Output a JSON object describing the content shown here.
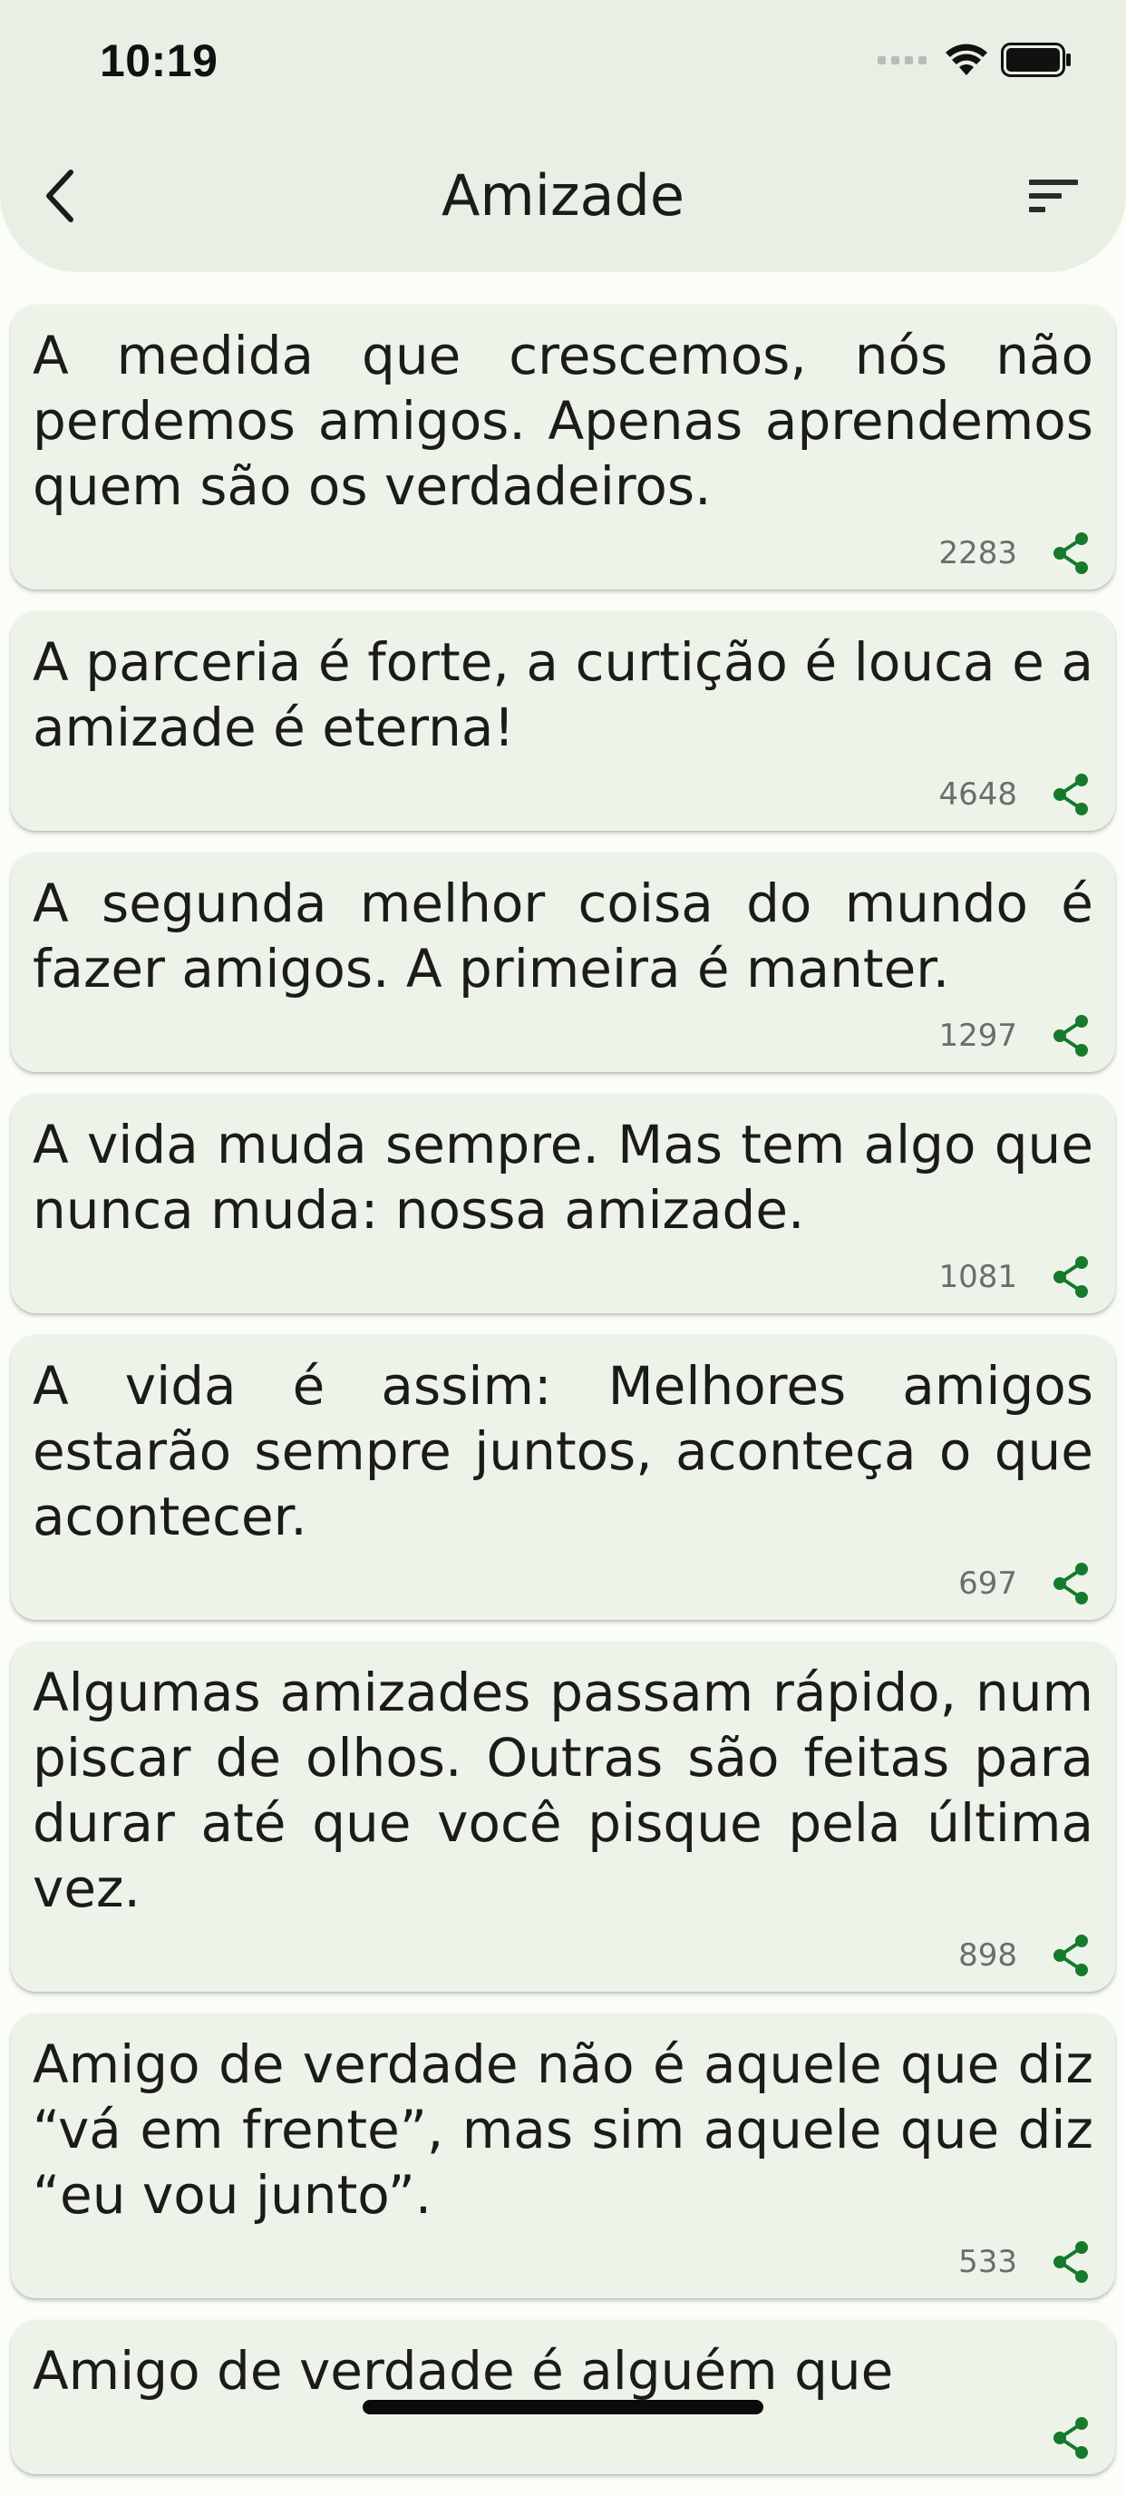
{
  "status_bar": {
    "time": "10:19"
  },
  "header": {
    "title": "Amizade"
  },
  "colors": {
    "accent": "#157a2c",
    "header_bg": "#e8efe4",
    "card_bg": "#eef3ea"
  },
  "icons": {
    "back": "chevron-left-icon",
    "sort": "sort-icon",
    "share": "share-icon"
  },
  "quotes": [
    {
      "text": "A medida que crescemos, nós não perdemos amigos. Apenas aprendemos quem são os verdadeiros.",
      "count": "2283"
    },
    {
      "text": "A parceria é forte, a curtição é louca e a amizade é eterna!",
      "count": "4648"
    },
    {
      "text": "A segunda melhor coisa do mundo é fazer amigos. A primeira é manter.",
      "count": "1297"
    },
    {
      "text": "A vida muda sempre. Mas tem algo que nunca muda: nossa amizade.",
      "count": "1081"
    },
    {
      "text": "A vida é assim: Melhores amigos estarão sempre juntos, aconteça o que acontecer.",
      "count": "697"
    },
    {
      "text": "Algumas amizades passam rápido, num piscar de olhos. Outras são feitas para durar até que você pisque pela última vez.",
      "count": "898"
    },
    {
      "text": "Amigo de verdade não é aquele que diz “vá em frente”, mas sim aquele que diz “eu vou junto”.",
      "count": "533"
    },
    {
      "text": "Amigo de verdade é alguém que",
      "count": ""
    }
  ]
}
